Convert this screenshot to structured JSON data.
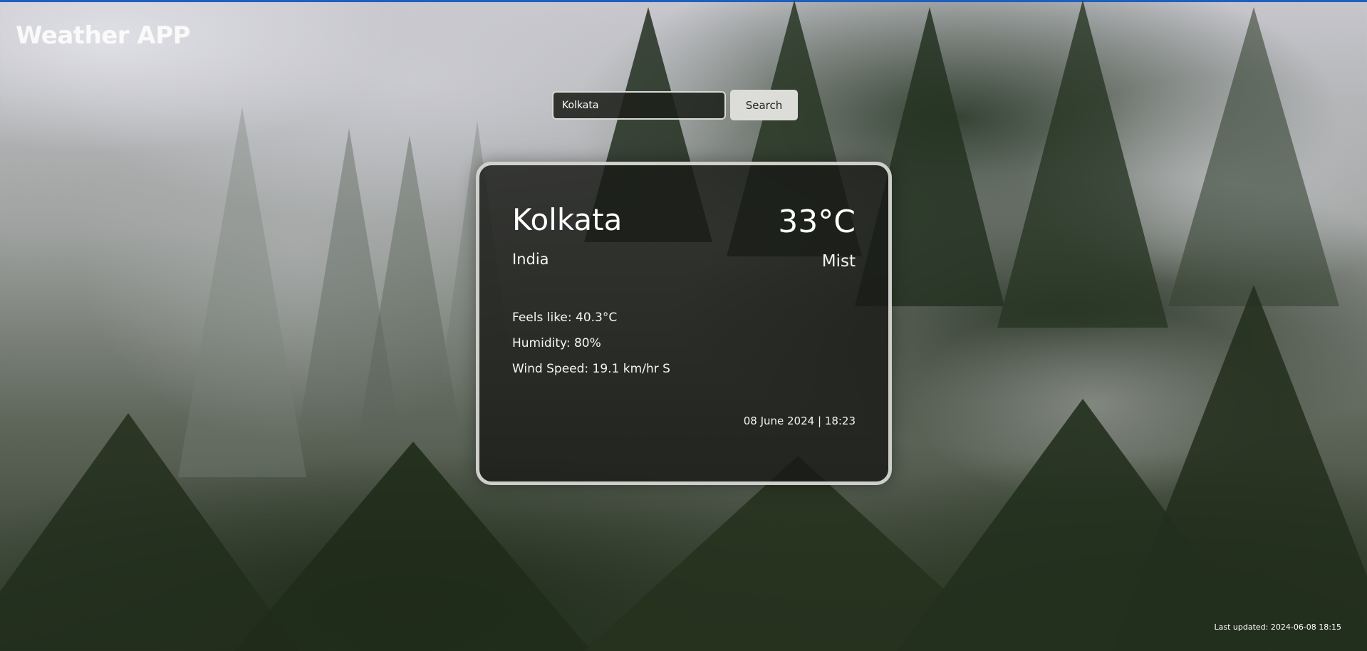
{
  "app": {
    "title": "Weather APP"
  },
  "search": {
    "value": "Kolkata",
    "button_label": "Search"
  },
  "weather": {
    "city": "Kolkata",
    "country": "India",
    "temperature": "33°C",
    "condition": "Mist",
    "feels_like": "Feels like: 40.3°C",
    "humidity": "Humidity: 80%",
    "wind_speed": "Wind Speed: 19.1 km/hr S",
    "datetime": "08 June 2024 | 18:23"
  },
  "footer": {
    "last_updated": "Last updated: 2024-06-08 18:15"
  },
  "colors": {
    "top_accent": "#1f5fbf",
    "card_background": "#181a16",
    "card_border": "#e1e1de",
    "search_button": "#dcdcd8"
  }
}
